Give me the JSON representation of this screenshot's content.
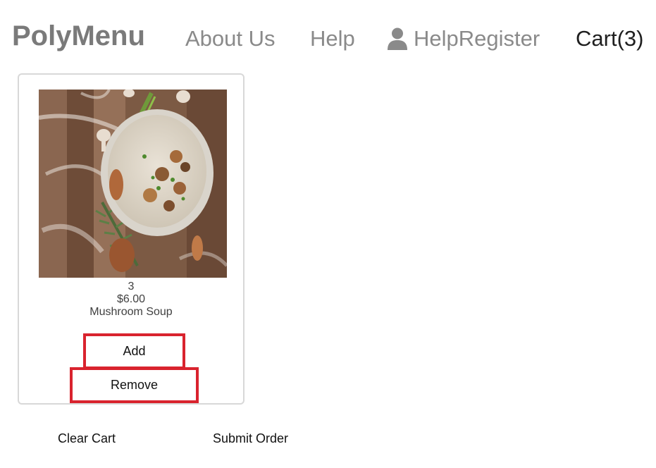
{
  "header": {
    "brand": "PolyMenu",
    "nav": {
      "about": "About Us",
      "help": "Help",
      "register_icon": "user-icon",
      "register": "HelpRegister",
      "cart": "Cart(3)"
    }
  },
  "cart": {
    "items": [
      {
        "image": "mushroom-soup-photo",
        "quantity": "3",
        "price": "$6.00",
        "name": "Mushroom Soup",
        "add_label": "Add",
        "remove_label": "Remove"
      }
    ]
  },
  "footer": {
    "clear_label": "Clear Cart",
    "submit_label": "Submit Order"
  },
  "colors": {
    "brand_gray": "#7a7a7a",
    "highlight_red": "#d9232e"
  }
}
